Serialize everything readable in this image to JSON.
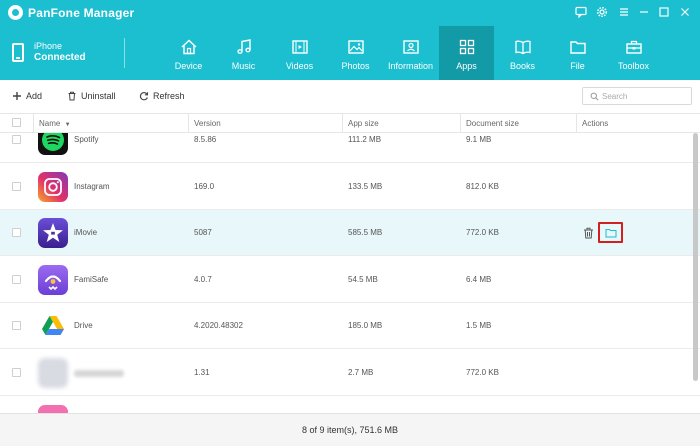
{
  "app": {
    "title": "PanFone Manager"
  },
  "device": {
    "name": "iPhone",
    "status": "Connected"
  },
  "nav": [
    {
      "label": "Device",
      "icon": "home-icon"
    },
    {
      "label": "Music",
      "icon": "music-icon"
    },
    {
      "label": "Videos",
      "icon": "film-icon"
    },
    {
      "label": "Photos",
      "icon": "image-icon"
    },
    {
      "label": "Information",
      "icon": "contact-card-icon"
    },
    {
      "label": "Apps",
      "icon": "apps-grid-icon",
      "active": true
    },
    {
      "label": "Books",
      "icon": "book-icon"
    },
    {
      "label": "File",
      "icon": "folder-icon"
    },
    {
      "label": "Toolbox",
      "icon": "toolbox-icon"
    }
  ],
  "toolbar": {
    "add_label": "Add",
    "uninstall_label": "Uninstall",
    "refresh_label": "Refresh"
  },
  "search": {
    "placeholder": "Search"
  },
  "table": {
    "columns": [
      "Name",
      "Version",
      "App size",
      "Document size",
      "Actions"
    ],
    "rows": [
      {
        "name": "Spotify",
        "version": "8.5.86",
        "app_size": "111.2 MB",
        "doc_size": "9.1 MB",
        "icon": "spotify-icon"
      },
      {
        "name": "Instagram",
        "version": "169.0",
        "app_size": "133.5 MB",
        "doc_size": "812.0 KB",
        "icon": "instagram-icon"
      },
      {
        "name": "iMovie",
        "version": "5087",
        "app_size": "585.5 MB",
        "doc_size": "772.0 KB",
        "icon": "imovie-icon",
        "selected": true
      },
      {
        "name": "FamiSafe",
        "version": "4.0.7",
        "app_size": "54.5 MB",
        "doc_size": "6.4 MB",
        "icon": "famisafe-icon"
      },
      {
        "name": "Drive",
        "version": "4.2020.48302",
        "app_size": "185.0 MB",
        "doc_size": "1.5 MB",
        "icon": "drive-icon"
      },
      {
        "name": "",
        "version": "1.31",
        "app_size": "2.7 MB",
        "doc_size": "772.0 KB",
        "icon": "blurred-app-icon"
      }
    ]
  },
  "footer": {
    "status": "8 of 9 item(s), 751.6 MB"
  },
  "colors": {
    "accent": "#1bbfcf",
    "accent_dark": "#139aa7",
    "highlight_border": "#d2201f",
    "selected_row": "#e8f7fa"
  }
}
